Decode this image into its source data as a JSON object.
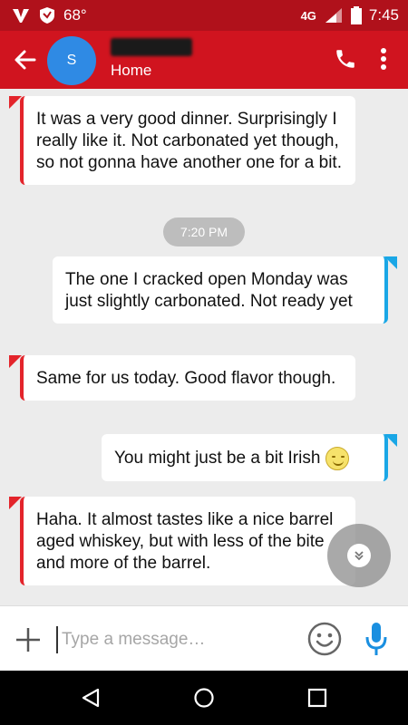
{
  "status_bar": {
    "temperature": "68°",
    "network": "4G",
    "network_sub": "LTE",
    "time": "7:45"
  },
  "app_bar": {
    "avatar_letter": "S",
    "contact_subtitle": "Home",
    "icons": [
      "arrow-left-icon",
      "phone-icon",
      "more-vertical-icon"
    ]
  },
  "messages": [
    {
      "direction": "incoming",
      "text": "It was a very good dinner. Surprisingly I really like it. Not carbonated yet though, so not gonna have another one for a bit."
    },
    {
      "direction": "outgoing",
      "text": "The one I cracked open Monday was just slightly carbonated. Not ready yet"
    },
    {
      "direction": "incoming",
      "text": "Same for us today. Good flavor though."
    },
    {
      "direction": "outgoing",
      "text": "You might just be a bit Irish"
    },
    {
      "direction": "incoming",
      "text": "Haha. It almost tastes like a nice barrel aged whiskey, but with less of the bite and more of the barrel."
    }
  ],
  "time_separator": "7:20 PM",
  "compose": {
    "placeholder": "Type a message…",
    "value": ""
  },
  "colors": {
    "status_bar": "#b0111b",
    "app_bar": "#d0141f",
    "incoming_accent": "#e3242b",
    "outgoing_accent": "#1aa7e6",
    "mic": "#1a8fe0"
  }
}
